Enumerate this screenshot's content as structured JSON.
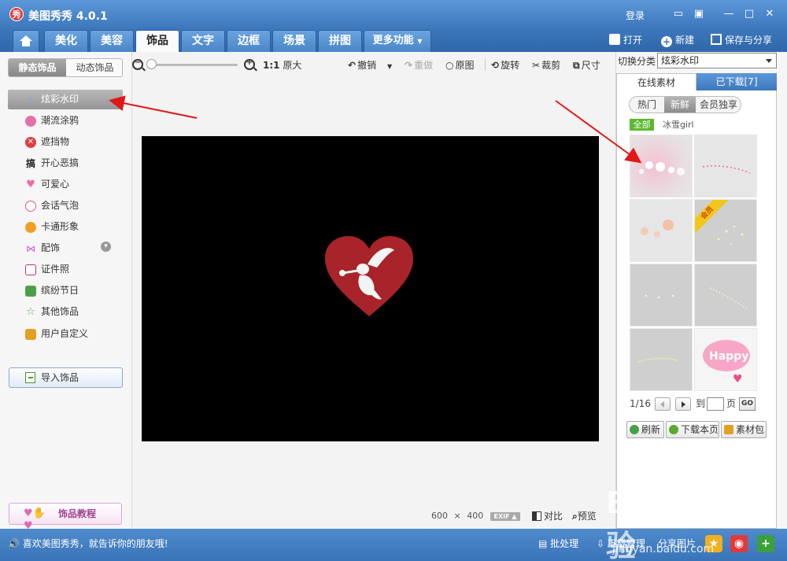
{
  "app": {
    "title": "美图秀秀 4.0.1",
    "logo_text": "秀",
    "login": "登录"
  },
  "nav": {
    "tabs": [
      "美化",
      "美容",
      "饰品",
      "文字",
      "边框",
      "场景",
      "拼图"
    ],
    "more": "更多功能",
    "active_tab": "饰品",
    "open": "打开",
    "new": "新建",
    "save_share": "保存与分享"
  },
  "sidebar": {
    "tab_static": "静态饰品",
    "tab_dynamic": "动态饰品",
    "items": [
      {
        "label": "炫彩水印",
        "icon": "sparkle-icon",
        "color": "#8ea6d8"
      },
      {
        "label": "潮流涂鸦",
        "icon": "lips-icon",
        "color": "#e86fa6"
      },
      {
        "label": "遮挡物",
        "icon": "mask-icon",
        "color": "#d94040"
      },
      {
        "label": "开心恶搞",
        "icon": "funny-icon",
        "color": "#222222"
      },
      {
        "label": "可爱心",
        "icon": "heart-icon",
        "color": "#f06aa8"
      },
      {
        "label": "会话气泡",
        "icon": "bubble-icon",
        "color": "#e05a7a"
      },
      {
        "label": "卡通形象",
        "icon": "cartoon-icon",
        "color": "#f0a020"
      },
      {
        "label": "配饰",
        "icon": "bow-icon",
        "color": "#d05ad0"
      },
      {
        "label": "证件照",
        "icon": "id-photo-icon",
        "color": "#c03070"
      },
      {
        "label": "缤纷节日",
        "icon": "gift-icon",
        "color": "#4aa04a"
      },
      {
        "label": "其他饰品",
        "icon": "star-icon",
        "color": "#5aaa5a"
      },
      {
        "label": "用户自定义",
        "icon": "folder-icon",
        "color": "#e0a020"
      }
    ],
    "import": "导入饰品",
    "tutorial": "饰品教程"
  },
  "toolbar": {
    "zoom_label": "1:1",
    "original_size": "原大",
    "undo": "撤销",
    "redo": "重做",
    "original": "原图",
    "rotate": "旋转",
    "crop": "裁剪",
    "resize": "尺寸"
  },
  "canvas": {
    "width_text": "600",
    "x_text": "×",
    "height_text": "400",
    "exif": "EXIF",
    "compare": "对比",
    "preview": "预览",
    "heart_color": "#a8232a"
  },
  "right_panel": {
    "switch_label": "切换分类",
    "switch_value": "炫彩水印",
    "tab_online": "在线素材",
    "tab_downloaded": "已下载[7]",
    "sub_tabs": [
      "热门",
      "新鲜",
      "会员独享"
    ],
    "active_sub_tab": "新鲜",
    "tag_all": "全部",
    "tag_user": "冰雪girl",
    "vip_badge": "会员",
    "pager_text": "1/16",
    "goto": "到",
    "page": "页",
    "go": "GO",
    "refresh": "刷新",
    "download_page": "下载本页",
    "pack": "素材包"
  },
  "statusbar": {
    "share_msg": "喜欢美图秀秀，就告诉你的朋友哦!",
    "batch": "批处理",
    "download_manage": "下载管理",
    "share_pic": "分享图片"
  },
  "watermark": {
    "brand": "Bai du 经验",
    "url": "jingyan.baidu.com"
  }
}
